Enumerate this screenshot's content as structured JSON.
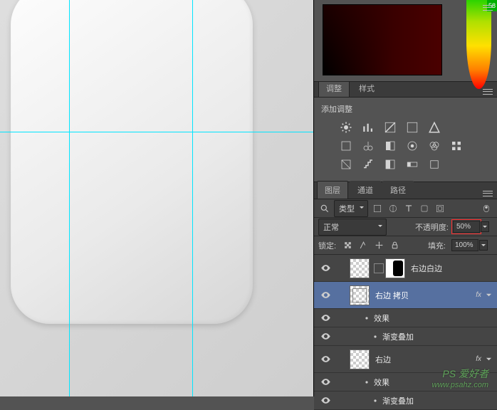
{
  "hueBadge": "58",
  "adj": {
    "tabs": [
      "调整",
      "样式"
    ],
    "title": "添加调整"
  },
  "layersPanel": {
    "tabs": [
      "图层",
      "通道",
      "路径"
    ],
    "typeFilter": "类型",
    "blendMode": "正常",
    "opacityLabel": "不透明度:",
    "opacityValue": "50%",
    "lockLabel": "锁定:",
    "fillLabel": "填充:",
    "fillValue": "100%"
  },
  "layers": [
    {
      "name": "右边白边",
      "fx": false,
      "selected": false,
      "mask": true
    },
    {
      "name": "右边 拷贝",
      "fx": true,
      "selected": true,
      "mask": false
    },
    {
      "name": "效果",
      "sub": true
    },
    {
      "name": "渐变叠加",
      "sub": true,
      "leaf": true
    },
    {
      "name": "右边",
      "fx": true,
      "selected": false,
      "mask": false
    },
    {
      "name": "效果",
      "sub": true
    },
    {
      "name": "渐变叠加",
      "sub": true,
      "leaf": true
    }
  ],
  "watermark": {
    "line1": "PS 爱好者",
    "line2": "www.psahz.com"
  }
}
